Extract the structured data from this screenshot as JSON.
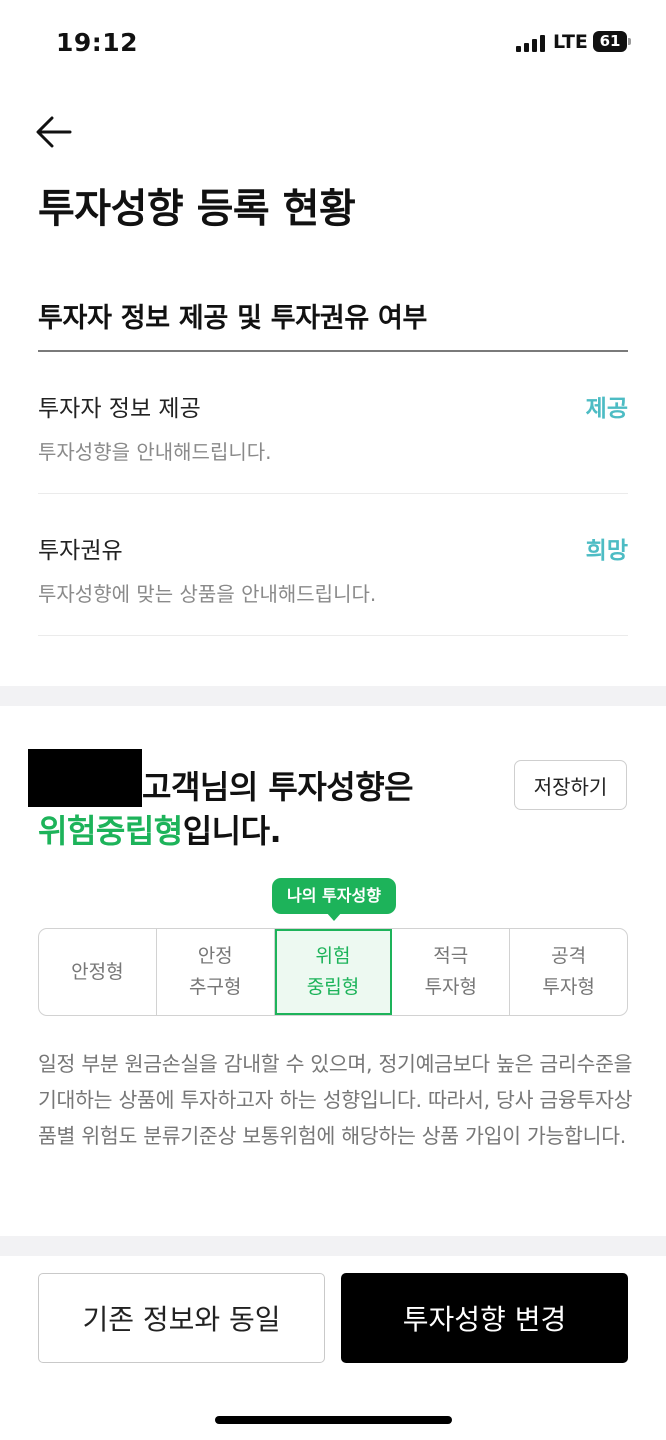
{
  "status_bar": {
    "time": "19:12",
    "network": "LTE",
    "battery": "61"
  },
  "header": {
    "back_icon": "back-arrow-icon",
    "title": "투자성향 등록 현황"
  },
  "consent_section": {
    "title": "투자자 정보 제공 및 투자권유 여부",
    "rows": [
      {
        "label": "투자자 정보 제공",
        "description": "투자성향을 안내해드립니다.",
        "value": "제공"
      },
      {
        "label": "투자권유",
        "description": "투자성향에 맞는 상품을 안내해드립니다.",
        "value": "희망"
      }
    ]
  },
  "profile_section": {
    "line1_suffix": "고객님의 투자성향은",
    "type_name": "위험중립형",
    "line2_suffix": "입니다.",
    "save_label": "저장하기",
    "my_tag_label": "나의 투자성향",
    "risk_levels": [
      {
        "label": "안정형",
        "active": false
      },
      {
        "label": "안정\n추구형",
        "active": false
      },
      {
        "label": "위험\n중립형",
        "active": true
      },
      {
        "label": "적극\n투자형",
        "active": false
      },
      {
        "label": "공격\n투자형",
        "active": false
      }
    ],
    "description": "일정 부분 원금손실을 감내할 수 있으며, 정기예금보다 높은 금리수준을 기대하는 상품에 투자하고자 하는 성향입니다. 따라서, 당사 금융투자상품별 위험도 분류기준상 보통위험에 해당하는 상품 가입이 가능합니다."
  },
  "footer": {
    "same_label": "기존 정보와 동일",
    "change_label": "투자성향 변경"
  },
  "colors": {
    "accent_green": "#1db35a",
    "value_teal": "#4dbcc4",
    "background_gray": "#f2f2f4"
  }
}
